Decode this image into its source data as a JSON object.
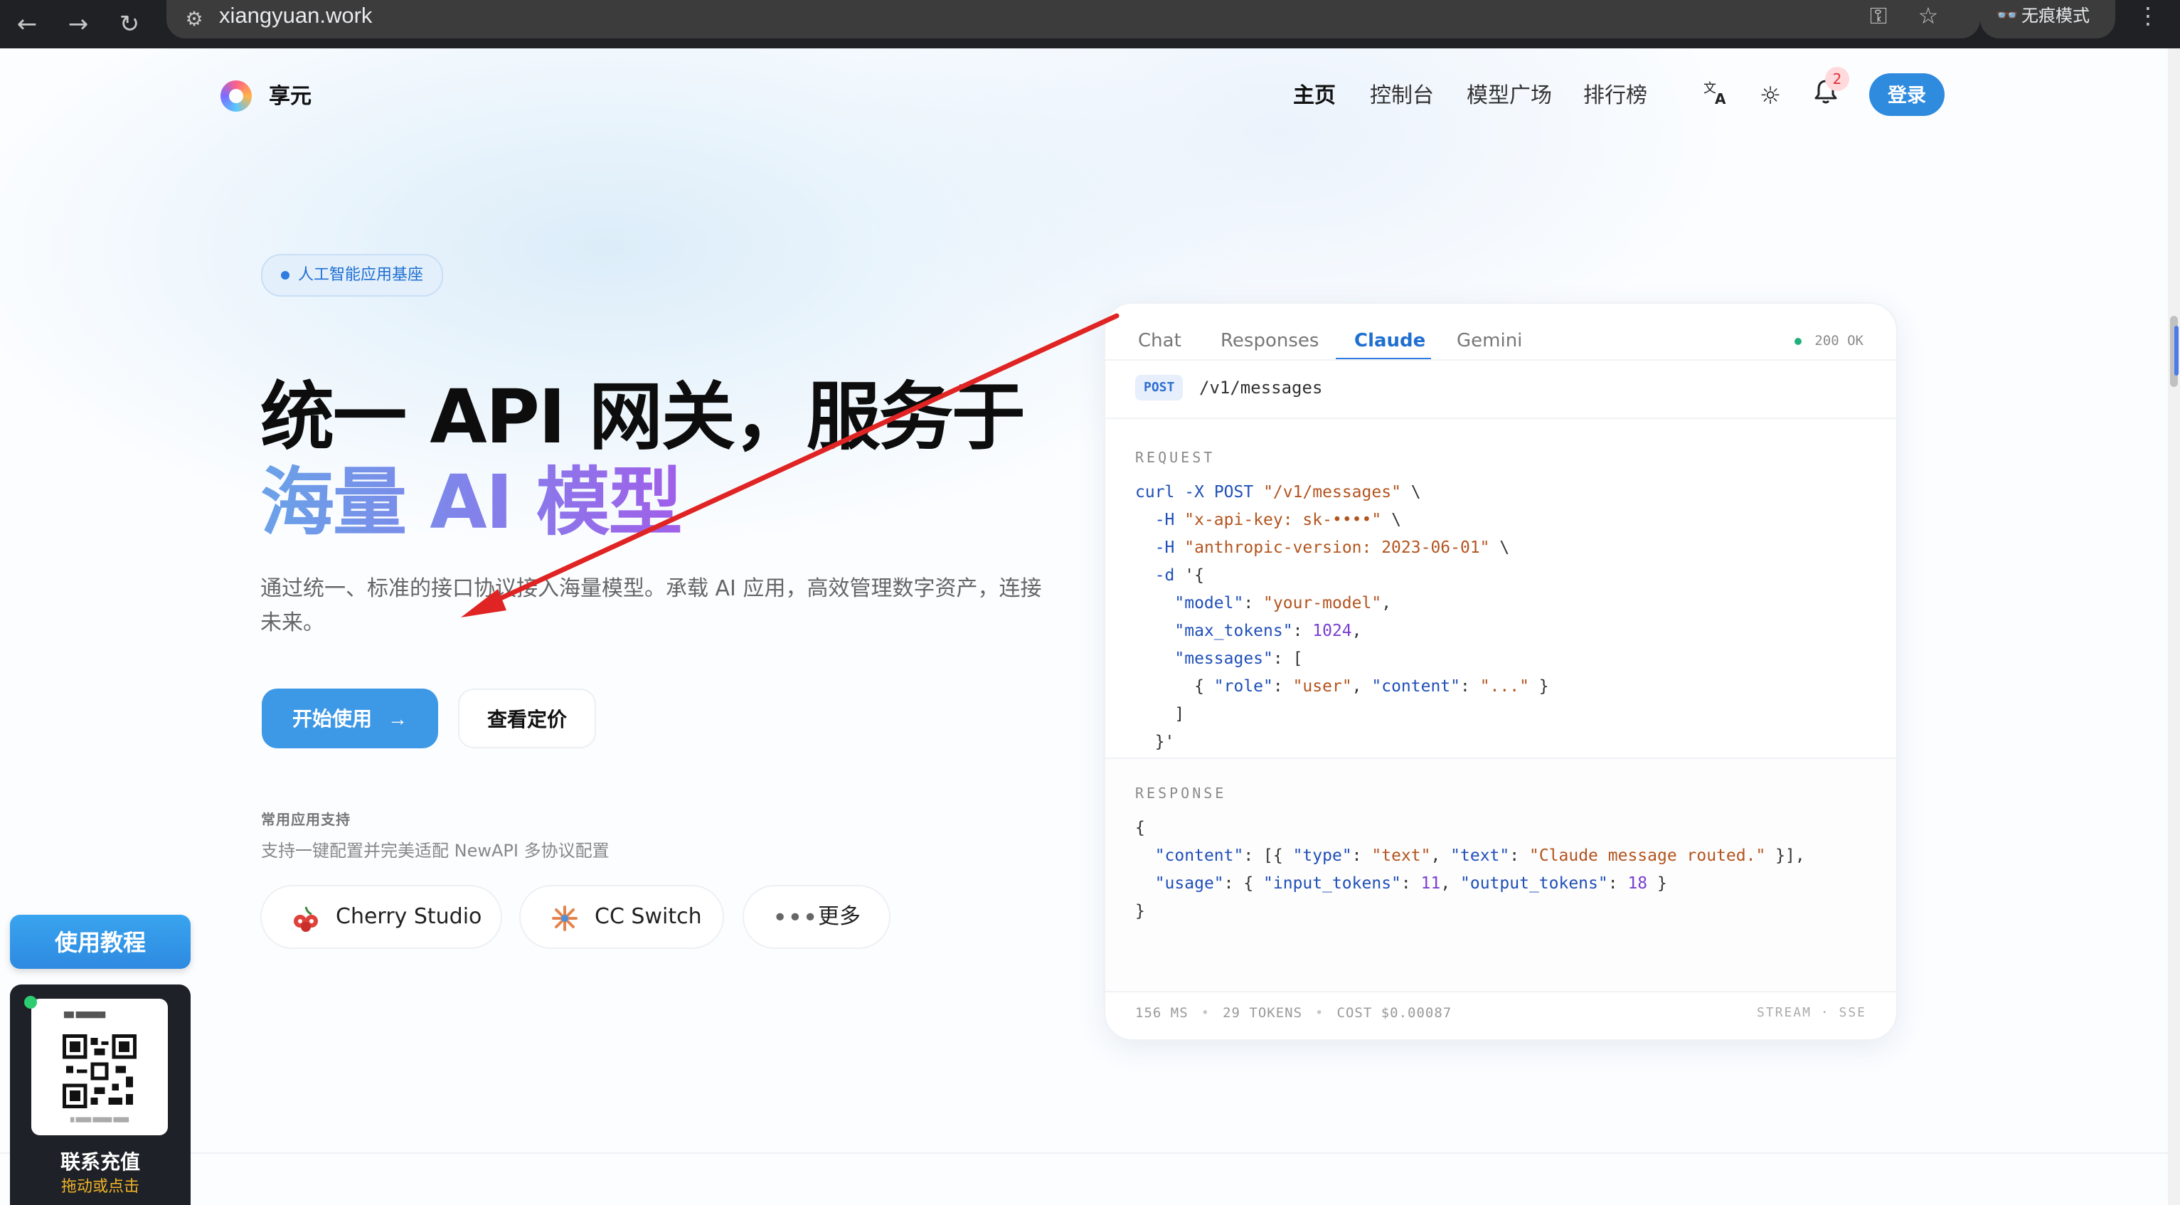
{
  "browser": {
    "url": "xiangyuan.work",
    "incognito_label": "无痕模式",
    "icons": [
      "back-icon",
      "forward-icon",
      "reload-icon",
      "site-settings-icon",
      "key-icon",
      "star-icon",
      "incognito-icon",
      "kebab-menu-icon"
    ]
  },
  "header": {
    "brand": "享元",
    "nav": [
      {
        "label": "主页",
        "active": true
      },
      {
        "label": "控制台",
        "active": false
      },
      {
        "label": "模型广场",
        "active": false
      },
      {
        "label": "排行榜",
        "active": false
      }
    ],
    "notification_count": "2",
    "login_label": "登录"
  },
  "hero": {
    "badge": "人工智能应用基座",
    "title_line1": "统一 API 网关，服务于",
    "title_line2": "海量 AI 模型",
    "description": "通过统一、标准的接口协议接入海量模型。承载 AI 应用，高效管理数字资产，连接未来。",
    "start_label": "开始使用",
    "pricing_label": "查看定价",
    "apps_heading": "常用应用支持",
    "apps_desc": "支持一键配置并完美适配 NewAPI 多协议配置",
    "apps": [
      {
        "label": "Cherry Studio",
        "icon": "cherry-icon"
      },
      {
        "label": "CC Switch",
        "icon": "cc-switch-icon"
      },
      {
        "label": "更多",
        "icon": "more-dots-icon"
      }
    ]
  },
  "panel": {
    "tabs": [
      {
        "label": "Chat",
        "active": false
      },
      {
        "label": "Responses",
        "active": false
      },
      {
        "label": "Claude",
        "active": true
      },
      {
        "label": "Gemini",
        "active": false
      }
    ],
    "status": "200 OK",
    "method": "POST",
    "endpoint": "/v1/messages",
    "request_label": "REQUEST",
    "response_label": "RESPONSE",
    "request_code": [
      "curl -X POST \"/v1/messages\" \\",
      "  -H \"x-api-key: sk-••••\" \\",
      "  -H \"anthropic-version: 2023-06-01\" \\",
      "  -d '{",
      "    \"model\": \"your-model\",",
      "    \"max_tokens\": 1024,",
      "    \"messages\": [",
      "      { \"role\": \"user\", \"content\": \"...\" }",
      "    ]",
      "  }'"
    ],
    "response_code": [
      "{",
      "  \"content\": [{ \"type\": \"text\", \"text\": \"Claude message routed.\" }],",
      "  \"usage\": { \"input_tokens\": 11, \"output_tokens\": 18 }",
      "}"
    ],
    "latency": "156 MS",
    "tokens": "29 TOKENS",
    "cost": "COST $0.00087",
    "stream": "STREAM · SSE"
  },
  "widgets": {
    "tutorial_label": "使用教程",
    "contact_title": "联系充值",
    "contact_sub": "拖动或点击"
  },
  "colors": {
    "accent": "#2f8bde",
    "tab_active": "#1f6fd1",
    "annotation_arrow": "#e02424"
  }
}
